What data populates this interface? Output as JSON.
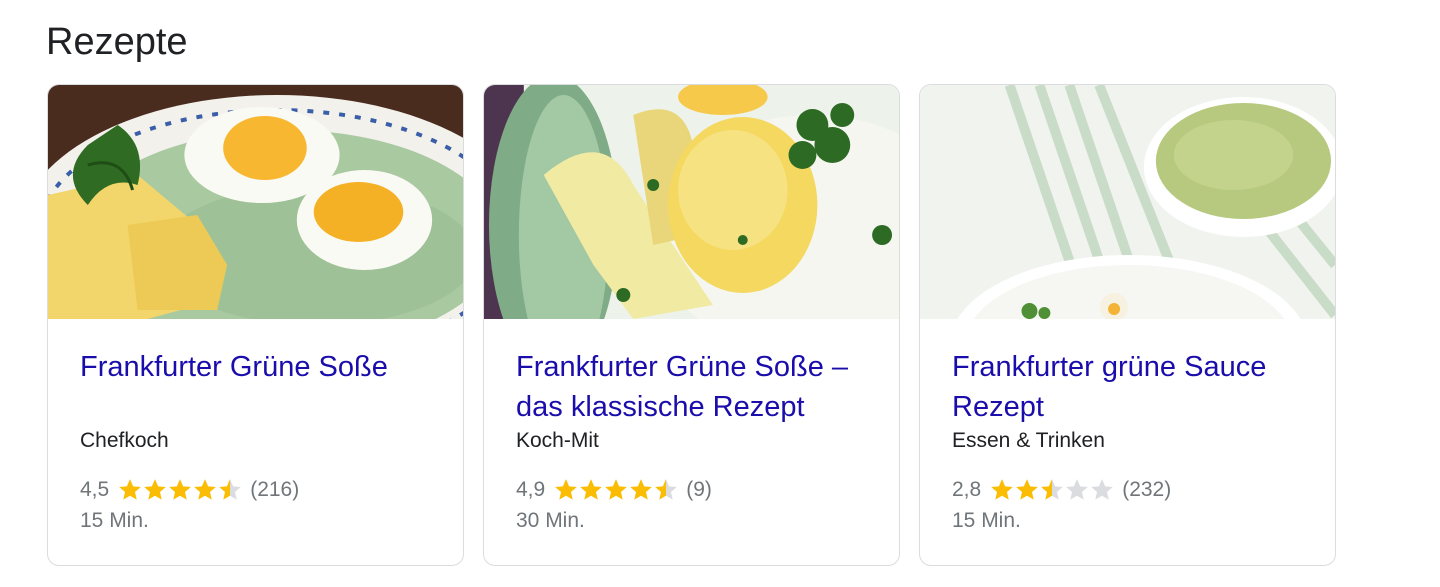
{
  "section": {
    "title": "Rezepte"
  },
  "colors": {
    "link": "#1a0dab",
    "star": "#fbbc04",
    "star_empty": "#dadce0"
  },
  "recipes": [
    {
      "title": "Frankfurter Grüne Soße",
      "source": "Chefkoch",
      "rating": "4,5",
      "rating_value": 4.5,
      "reviews": "(216)",
      "time": "15 Min."
    },
    {
      "title": "Frankfurter Grüne Soße – das klassische Rezept",
      "source": "Koch-Mit",
      "rating": "4,9",
      "rating_value": 4.9,
      "reviews": "(9)",
      "time": "30 Min."
    },
    {
      "title": "Frankfurter grüne Sauce Rezept",
      "source": "Essen & Trinken",
      "rating": "2,8",
      "rating_value": 2.8,
      "reviews": "(232)",
      "time": "15 Min."
    }
  ]
}
